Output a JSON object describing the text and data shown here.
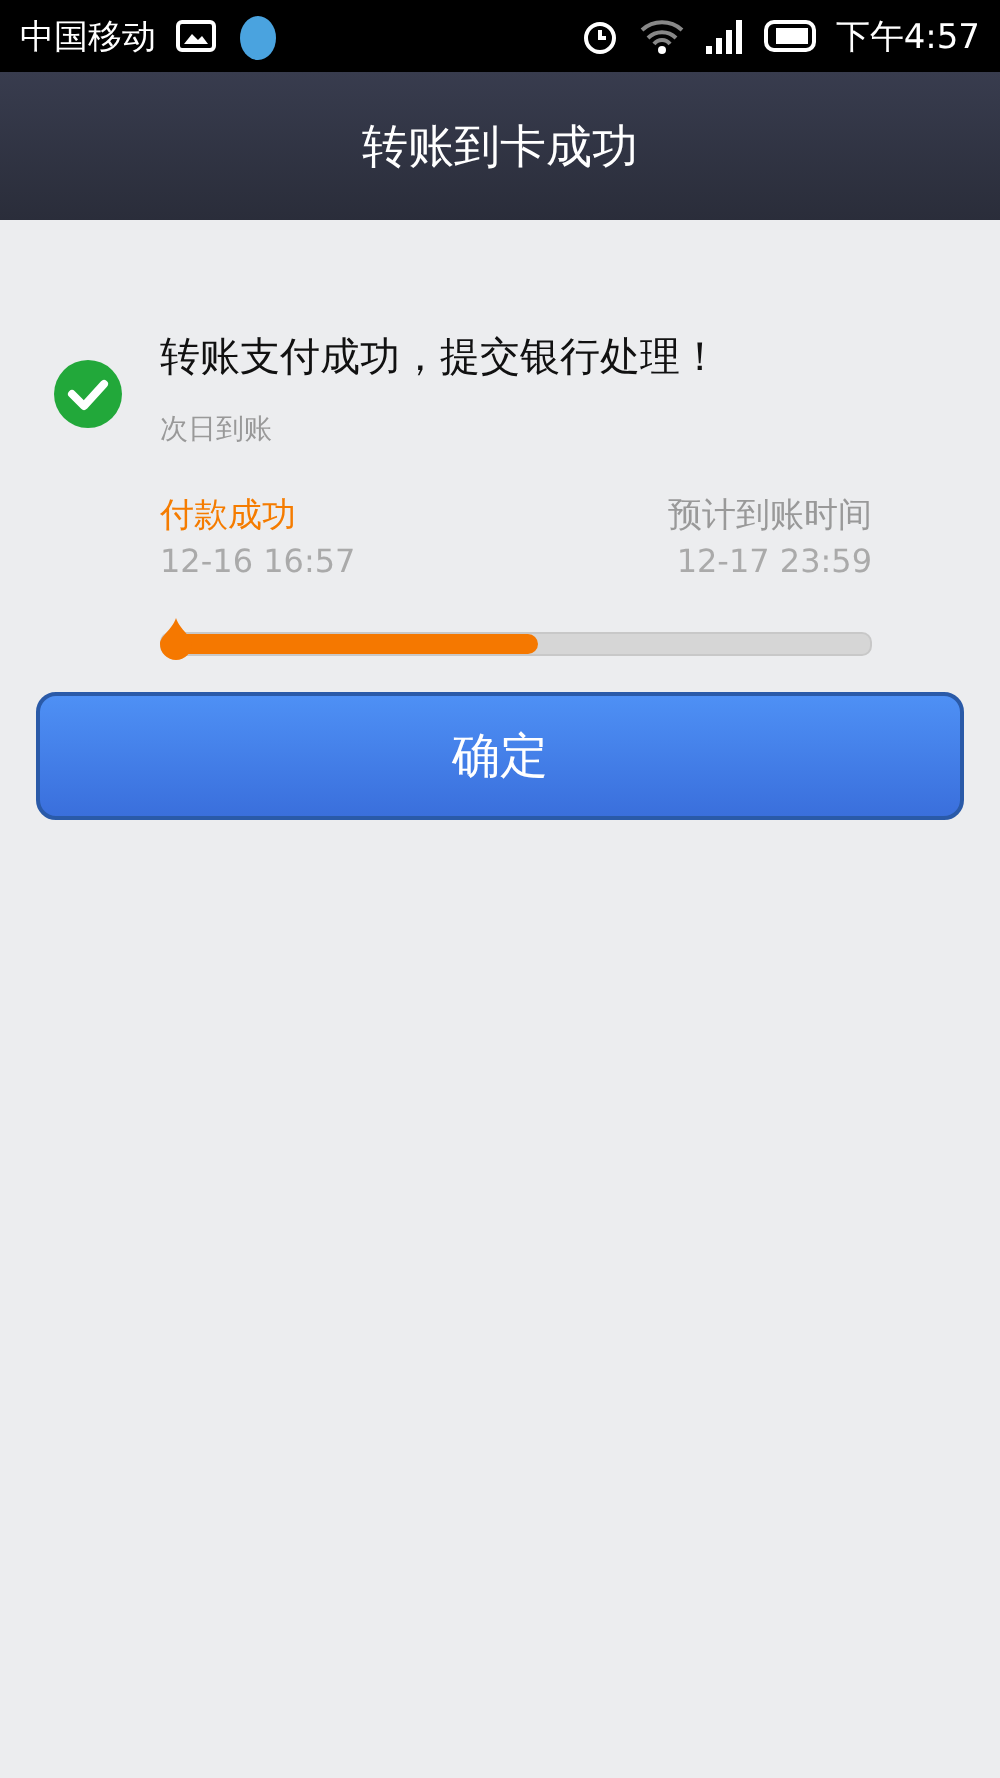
{
  "status_bar": {
    "carrier": "中国移动",
    "time": "下午4:57"
  },
  "header": {
    "title": "转账到卡成功"
  },
  "result": {
    "message": "转账支付成功，提交银行处理！",
    "subtitle": "次日到账"
  },
  "progress": {
    "start_label": "付款成功",
    "start_time": "12-16 16:57",
    "end_label": "预计到账时间",
    "end_time": "12-17 23:59",
    "level": 0.53
  },
  "buttons": [
    "确定"
  ]
}
